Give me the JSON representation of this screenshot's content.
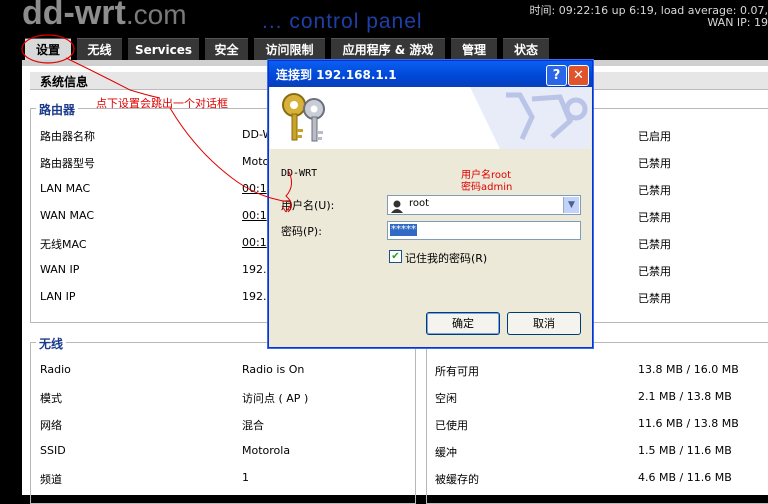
{
  "header": {
    "logo_main": "dd-wrt",
    "logo_suffix": ".com",
    "subtitle": "... control panel",
    "status_line1": "时间: 09:22:16 up 6:19, load average: 0.07,",
    "status_line2": "WAN IP: 19"
  },
  "tabs": [
    {
      "label": "设置"
    },
    {
      "label": "无线"
    },
    {
      "label": "Services"
    },
    {
      "label": "安全"
    },
    {
      "label": "访问限制"
    },
    {
      "label": "应用程序 & 游戏"
    },
    {
      "label": "管理"
    },
    {
      "label": "状态"
    }
  ],
  "system_info": {
    "heading": "系统信息",
    "router_title": "路由器",
    "router_rows": [
      {
        "label": "路由器名称",
        "value": "DD-W"
      },
      {
        "label": "路由器型号",
        "value": "Motor"
      },
      {
        "label": "LAN MAC",
        "value": "00:1"
      },
      {
        "label": "WAN MAC",
        "value": "00:1"
      },
      {
        "label": "无线MAC",
        "value": "00:1"
      },
      {
        "label": "WAN IP",
        "value": "192.1"
      },
      {
        "label": "LAN IP",
        "value": "192.1"
      }
    ],
    "right_values": [
      "已启用",
      "已禁用",
      "已禁用",
      "已禁用",
      "已禁用",
      "已禁用",
      "已禁用"
    ]
  },
  "wireless": {
    "title": "无线",
    "rows": [
      {
        "label": "Radio",
        "value": "Radio is On"
      },
      {
        "label": "模式",
        "value": "访问点 ( AP )"
      },
      {
        "label": "网络",
        "value": "混合"
      },
      {
        "label": "SSID",
        "value": "Motorola"
      },
      {
        "label": "频道",
        "value": "1"
      }
    ]
  },
  "memory": {
    "rows": [
      {
        "label": "所有可用",
        "value": "13.8 MB / 16.0 MB"
      },
      {
        "label": "空闲",
        "value": "2.1 MB / 13.8 MB"
      },
      {
        "label": "已使用",
        "value": "11.6 MB / 13.8 MB"
      },
      {
        "label": "缓冲",
        "value": "1.5 MB / 11.6 MB"
      },
      {
        "label": "被缓存的",
        "value": "4.6 MB / 11.6 MB"
      }
    ]
  },
  "dialog": {
    "title": "连接到 192.168.1.1",
    "realm": "DD-WRT",
    "username_label": "用户名(U):",
    "username_value": "root",
    "password_label": "密码(P):",
    "password_value": "*****",
    "remember_label": "记住我的密码(R)",
    "ok_label": "确定",
    "cancel_label": "取消",
    "help_glyph": "?",
    "close_glyph": "✕"
  },
  "annotations": {
    "setup_hint": "点下设置会跳出一个对话框",
    "cred_line1": "用户名root",
    "cred_line2": "密码admin"
  },
  "colors": {
    "accent_blue": "#1b3a8c",
    "annotation_red": "#e00000",
    "dialog_title_blue": "#0047d6"
  }
}
